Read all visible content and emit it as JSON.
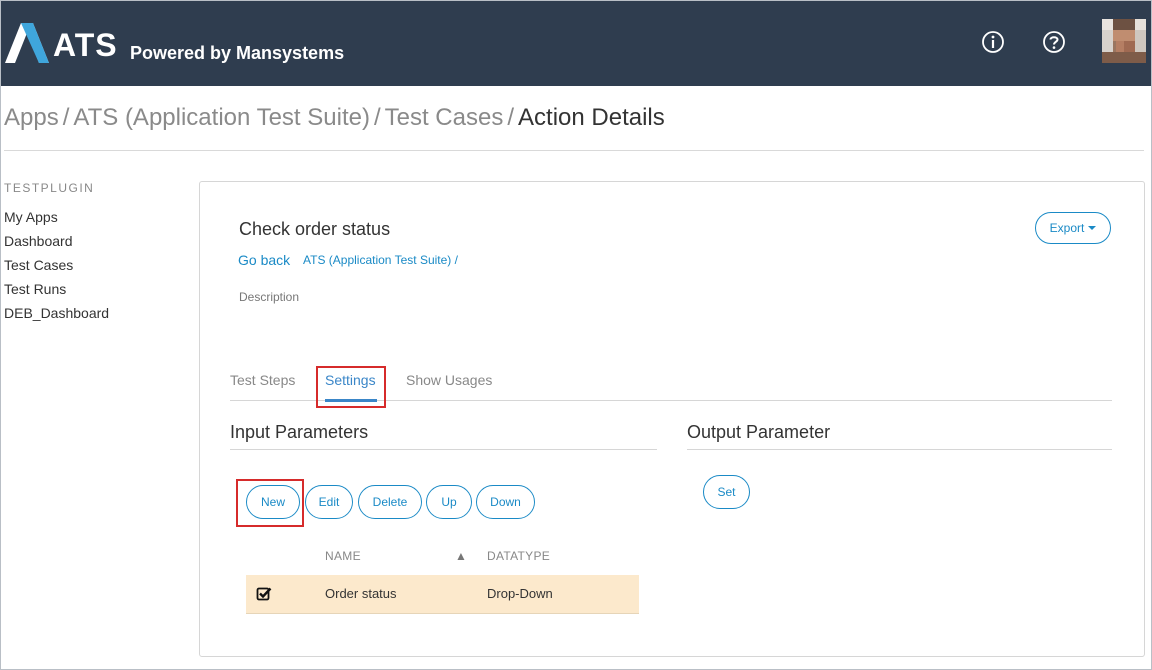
{
  "header": {
    "logo_text": "ATS",
    "logo_subtitle": "Powered by Mansystems",
    "icons": [
      "info-icon",
      "help-icon",
      "user-avatar"
    ]
  },
  "breadcrumb": {
    "items": [
      "Apps",
      "ATS (Application Test Suite)",
      "Test Cases"
    ],
    "separator": "/",
    "current": "Action Details"
  },
  "sidebar": {
    "heading": "TESTPLUGIN",
    "items": [
      "My Apps",
      "Dashboard",
      "Test Cases",
      "Test Runs",
      "DEB_Dashboard"
    ]
  },
  "main": {
    "title": "Check order status",
    "go_back": "Go back",
    "path_link": "ATS (Application Test Suite) /",
    "description_label": "Description",
    "export_label": "Export",
    "tabs": [
      {
        "label": "Test Steps",
        "active": false
      },
      {
        "label": "Settings",
        "active": true
      },
      {
        "label": "Show Usages",
        "active": false
      }
    ]
  },
  "input_parameters": {
    "title": "Input Parameters",
    "buttons": [
      "New",
      "Edit",
      "Delete",
      "Up",
      "Down"
    ],
    "columns": [
      "NAME",
      "DATATYPE"
    ],
    "sort_indicator": "▲",
    "rows": [
      {
        "checked": true,
        "name": "Order status",
        "datatype": "Drop-Down"
      }
    ]
  },
  "output_parameter": {
    "title": "Output Parameter",
    "set_label": "Set"
  },
  "colors": {
    "header_bg": "#2f3d4f",
    "accent": "#1a8ac6",
    "tab_active": "#3a86c8",
    "row_selected": "#fce9cc",
    "highlight": "#d62b2b"
  }
}
